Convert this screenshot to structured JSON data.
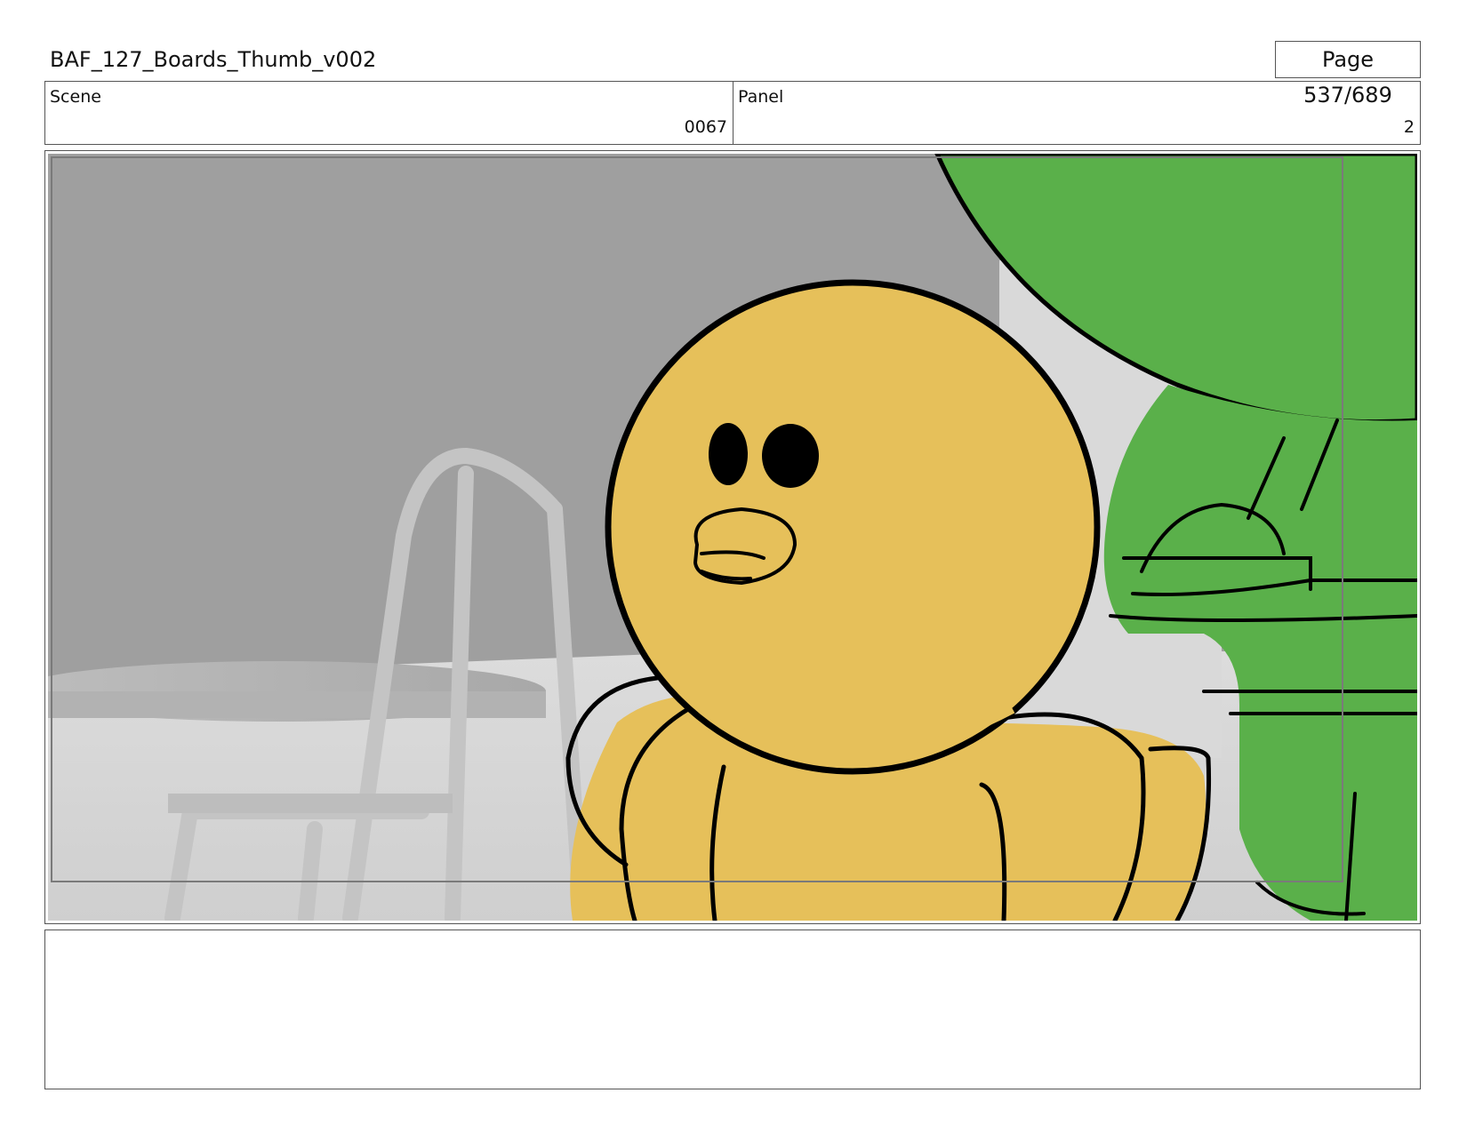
{
  "header": {
    "title": "BAF_127_Boards_Thumb_v002",
    "page": "Page 537/689"
  },
  "info": {
    "scene_label": "Scene",
    "scene_value": "0067",
    "panel_label": "Panel",
    "panel_value": "2"
  },
  "frame": {
    "description_colors": {
      "background": "#9e9e9e",
      "character_fill": "#e6c05a",
      "green_character": "#5ab04a",
      "outline": "#000000"
    }
  },
  "notes": {
    "text": ""
  }
}
